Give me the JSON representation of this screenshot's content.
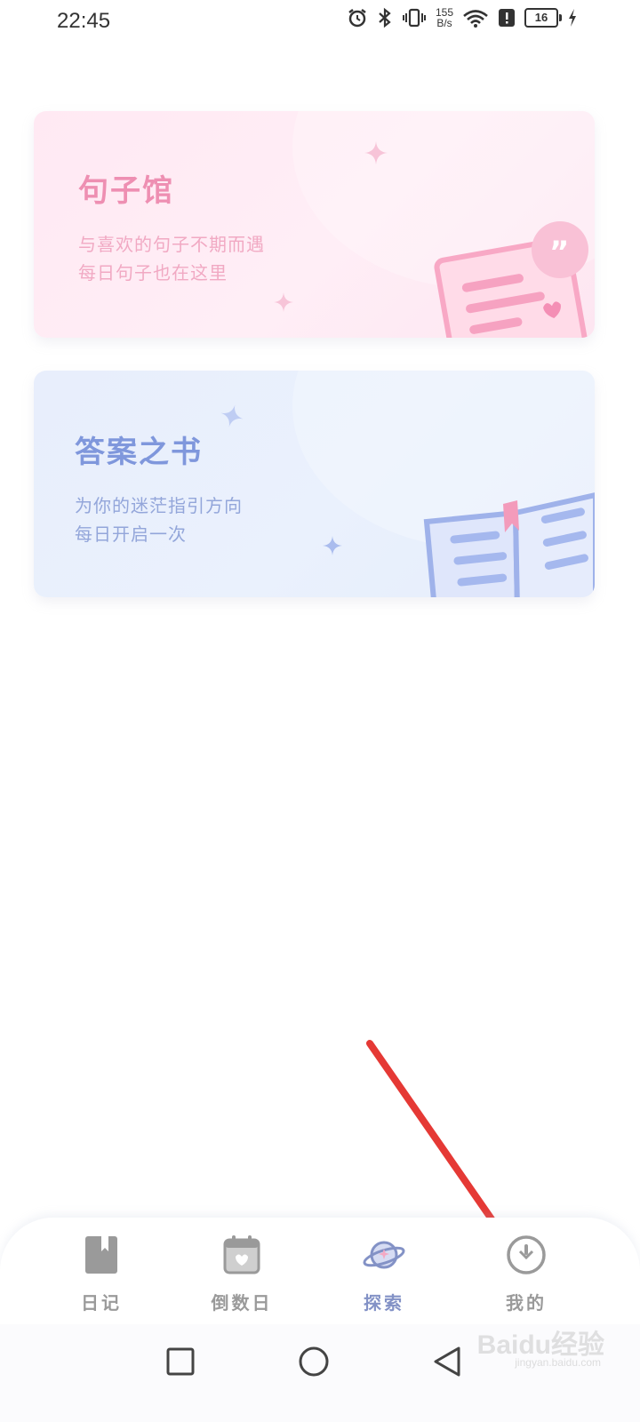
{
  "status_bar": {
    "time": "22:45",
    "speed_value": "155",
    "speed_unit": "B/s",
    "battery": "16",
    "icons": [
      "alarm-icon",
      "bluetooth-icon",
      "vibrate-icon",
      "wifi-icon",
      "alert-icon",
      "battery-icon",
      "charging-icon"
    ]
  },
  "cards": [
    {
      "title": "句子馆",
      "line1": "与喜欢的句子不期而遇",
      "line2": "每日句子也在这里",
      "illustration": "quote-paper-icon",
      "accent": "#ee8fb2"
    },
    {
      "title": "答案之书",
      "line1": "为你的迷茫指引方向",
      "line2": "每日开启一次",
      "illustration": "open-book-icon",
      "accent": "#7f97dc"
    }
  ],
  "tab_bar": {
    "tabs": [
      {
        "label": "日记",
        "icon": "diary-icon",
        "active": false
      },
      {
        "label": "倒数日",
        "icon": "calendar-heart-icon",
        "active": false
      },
      {
        "label": "探索",
        "icon": "planet-icon",
        "active": true
      },
      {
        "label": "我的",
        "icon": "profile-icon",
        "active": false
      }
    ],
    "active_color": "#8392c6",
    "inactive_color": "#9a9a9a"
  },
  "nav_bar": {
    "buttons": [
      "recents-button",
      "home-button",
      "back-button"
    ]
  },
  "watermark": {
    "text": "Baidu经验",
    "sub": "jingyan.baidu.com"
  },
  "annotation": {
    "arrow_color": "#e53935"
  }
}
